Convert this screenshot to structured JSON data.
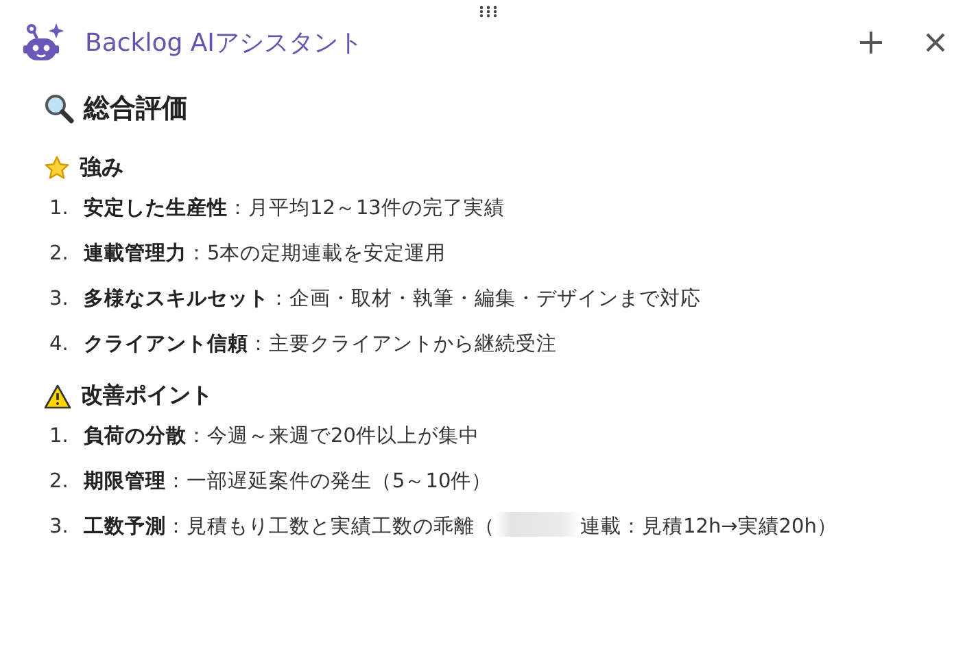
{
  "header": {
    "title": "Backlog AIアシスタント"
  },
  "heading": {
    "title": "総合評価"
  },
  "sections": [
    {
      "kind": "star",
      "title": "強み",
      "items": [
        {
          "number": "1.",
          "text": "**安定した生産性**：月平均12～13件の完了実績",
          "redacted": false
        },
        {
          "number": "2.",
          "text": "**連載管理力**：5本の定期連載を安定運用",
          "redacted": false
        },
        {
          "number": "3.",
          "text": "**多様なスキルセット**：企画・取材・執筆・編集・デザインまで対応",
          "redacted": false
        },
        {
          "number": "4.",
          "text": "**クライアント信頼**：主要クライアントから継続受注",
          "redacted": false
        }
      ]
    },
    {
      "kind": "warning",
      "title": "改善ポイント",
      "items": [
        {
          "number": "1.",
          "text": "**負荷の分散**：今週～来週で20件以上が集中",
          "redacted": false
        },
        {
          "number": "2.",
          "text": "**期限管理**：一部遅延案件の発生（5～10件）",
          "redacted": false
        },
        {
          "number": "3.",
          "text": "**工数予測**：見積もり工数と実績工数の乖離（",
          "redacted": true,
          "text_after": "連載：見積12h→実績20h）"
        }
      ]
    }
  ]
}
